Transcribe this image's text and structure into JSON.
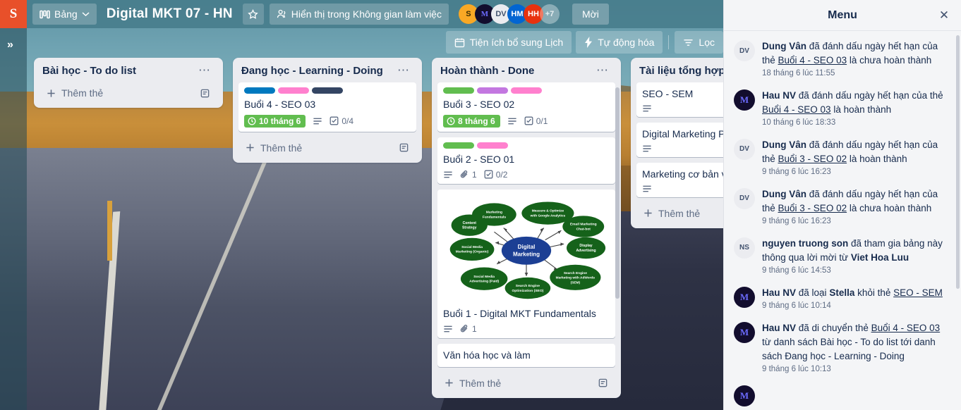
{
  "header": {
    "logo_text": "S",
    "boards_button": "Bảng",
    "boards_icon": "board-grid-icon",
    "chevron_icon": "chevron-down-icon",
    "board_title": "Digital MKT 07 - HN",
    "star_icon": "star-icon",
    "visibility_label": "Hiển thị trong Không gian làm việc",
    "visibility_icon": "people-icon",
    "invite_button": "Mời",
    "members": [
      {
        "initials": "S",
        "color": "#f9a825",
        "text_color": "#3b2c00"
      },
      {
        "initials": "M",
        "color": "#120d2e",
        "text_color": "#6c6bff"
      },
      {
        "initials": "DV",
        "color": "#ebecf0",
        "text_color": "#42526e"
      },
      {
        "initials": "HM",
        "color": "#0265d2",
        "text_color": "#ffffff"
      },
      {
        "initials": "HH",
        "color": "#e8320f",
        "text_color": "#ffffff"
      }
    ],
    "members_overflow": "+7"
  },
  "toolbar": {
    "calendar_button": "Tiện ích bổ sung Lịch",
    "calendar_icon": "calendar-icon",
    "automation_button": "Tự động hóa",
    "automation_icon": "lightning-bolt-icon",
    "filter_button": "Lọc",
    "filter_icon": "filter-icon"
  },
  "sidebar_rail": {
    "expand_icon": "double-chevron-right-icon"
  },
  "board": {
    "add_card_label": "Thêm thẻ",
    "add_card_icon": "plus-icon",
    "template_icon": "card-template-icon",
    "list_menu_icon": "ellipsis-icon",
    "lists": [
      {
        "title": "Bài học - To do list",
        "cards": []
      },
      {
        "title": "Đang học - Learning - Doing",
        "cards": [
          {
            "title": "Buổi 4 - SEO 03",
            "labels": [
              "#0079bf",
              "#ff80ce",
              "#344563"
            ],
            "due": "10 tháng 6",
            "due_icon": "clock-icon",
            "description_icon": "description-icon",
            "checklist": "0/4",
            "checklist_icon": "checklist-icon"
          }
        ]
      },
      {
        "title": "Hoàn thành - Done",
        "cards": [
          {
            "title": "Buổi 3 - SEO 02",
            "labels": [
              "#61bd4f",
              "#c377e0",
              "#ff80ce"
            ],
            "due": "8 tháng 6",
            "due_icon": "clock-icon",
            "description_icon": "description-icon",
            "checklist": "0/1",
            "checklist_icon": "checklist-icon"
          },
          {
            "title": "Buổi 2 - SEO 01",
            "labels": [
              "#61bd4f",
              "#ff80ce"
            ],
            "description_icon": "description-icon",
            "attachments": "1",
            "attachment_icon": "paperclip-icon",
            "checklist": "0/2",
            "checklist_icon": "checklist-icon"
          },
          {
            "title": "Buổi 1 - Digital MKT Fundamentals",
            "cover": "digital-marketing-mindmap",
            "description_icon": "description-icon",
            "attachments": "1",
            "attachment_icon": "paperclip-icon"
          },
          {
            "title": "Văn hóa học và làm"
          }
        ]
      },
      {
        "title": "Tài liệu tổng hợp",
        "cards": [
          {
            "title": "SEO - SEM",
            "description_icon": "description-icon"
          },
          {
            "title": "Digital Marketing Pr",
            "description_icon": "description-icon"
          },
          {
            "title": "Marketing cơ bản và",
            "description_icon": "description-icon"
          }
        ]
      }
    ]
  },
  "cover_diagram": {
    "center": "Digital Marketing",
    "nodes": [
      "Marketing Fundamentals",
      "Measure & Optimize with Google Analytics",
      "Email Marketing Chat-bot",
      "Display Advertising",
      "Search Engine Marketing with AdWords (SEM)",
      "Search Engine Optimization (SEO)",
      "Social Media Advertising (Paid)",
      "Social Media Marketing (Organic)",
      "Content Strategy"
    ]
  },
  "menu": {
    "title": "Menu",
    "close_icon": "close-icon",
    "activities": [
      {
        "avatar": {
          "initials": "DV",
          "color": "#ebecf0",
          "text_color": "#42526e"
        },
        "actor": "Dung Vân",
        "text_1": " đã đánh dấu ngày hết hạn của thẻ ",
        "link": "Buổi 4 - SEO 03",
        "text_2": " là chưa hoàn thành",
        "time": "18 tháng 6 lúc 11:55"
      },
      {
        "avatar": {
          "initials": "M",
          "color": "#120d2e",
          "text_color": "#6c6bff"
        },
        "actor": "Hau NV",
        "text_1": " đã đánh dấu ngày hết hạn của thẻ ",
        "link": "Buổi 4 - SEO 03",
        "text_2": " là hoàn thành",
        "time": "10 tháng 6 lúc 18:33"
      },
      {
        "avatar": {
          "initials": "DV",
          "color": "#ebecf0",
          "text_color": "#42526e"
        },
        "actor": "Dung Vân",
        "text_1": " đã đánh dấu ngày hết hạn của thẻ ",
        "link": "Buổi 3 - SEO 02",
        "text_2": " là hoàn thành",
        "time": "9 tháng 6 lúc 16:23"
      },
      {
        "avatar": {
          "initials": "DV",
          "color": "#ebecf0",
          "text_color": "#42526e"
        },
        "actor": "Dung Vân",
        "text_1": " đã đánh dấu ngày hết hạn của thẻ ",
        "link": "Buổi 3 - SEO 02",
        "text_2": " là chưa hoàn thành",
        "time": "9 tháng 6 lúc 16:23"
      },
      {
        "avatar": {
          "initials": "NS",
          "color": "#ebecf0",
          "text_color": "#42526e"
        },
        "actor": "nguyen truong son",
        "text_1": " đã tham gia bảng này thông qua lời mời từ ",
        "link": "",
        "bold_2": "Viet Hoa Luu",
        "text_2": "",
        "time": "9 tháng 6 lúc 14:53"
      },
      {
        "avatar": {
          "initials": "M",
          "color": "#120d2e",
          "text_color": "#6c6bff"
        },
        "actor": "Hau NV",
        "text_1": " đã loại ",
        "bold_mid": "Stella",
        "text_mid": " khỏi thẻ ",
        "link": "SEO - SEM",
        "text_2": "",
        "time": "9 tháng 6 lúc 10:14"
      },
      {
        "avatar": {
          "initials": "M",
          "color": "#120d2e",
          "text_color": "#6c6bff"
        },
        "actor": "Hau NV",
        "text_1": " đã di chuyển thẻ ",
        "link": "Buổi 4 - SEO 03",
        "text_2": " từ danh sách Bài học - To do list tới danh sách Đang học - Learning - Doing",
        "time": "9 tháng 6 lúc 10:13"
      }
    ]
  }
}
